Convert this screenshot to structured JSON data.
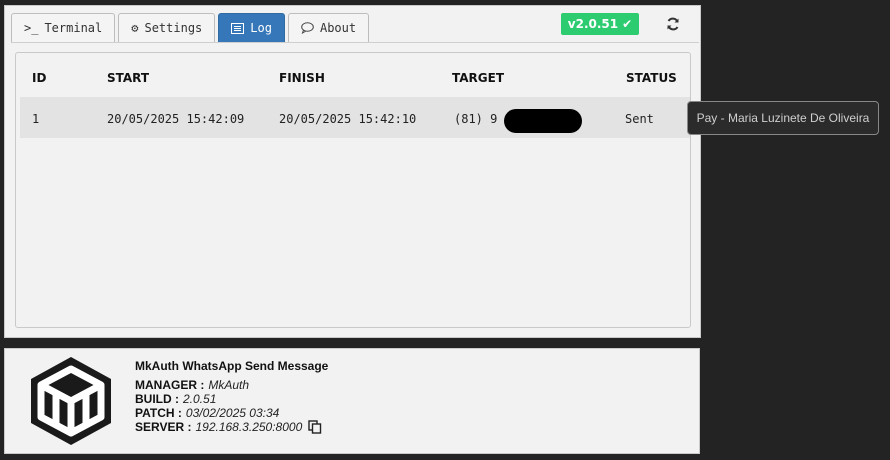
{
  "tabs": [
    {
      "label": "Terminal",
      "icon": "terminal-icon"
    },
    {
      "label": "Settings",
      "icon": "gears-icon"
    },
    {
      "label": "Log",
      "icon": "list-icon",
      "active": true
    },
    {
      "label": "About",
      "icon": "comment-icon"
    }
  ],
  "version_badge": {
    "label": "v2.0.51",
    "icon": "check-icon",
    "color": "#2ecc71"
  },
  "refresh_icon": "refresh-icon",
  "log_table": {
    "headers": [
      "ID",
      "START",
      "FINISH",
      "TARGET",
      "STATUS"
    ],
    "rows": [
      {
        "id": "1",
        "start": "20/05/2025 15:42:09",
        "finish": "20/05/2025 15:42:10",
        "target": "(81) 9",
        "status": "Sent"
      }
    ]
  },
  "tooltip": "Pay - Maria Luzinete De Oliveira",
  "about": {
    "title": "MkAuth WhatsApp Send Message",
    "manager_label": "MANAGER :",
    "manager_value": "MkAuth",
    "build_label": "BUILD :",
    "build_value": "2.0.51",
    "patch_label": "PATCH :",
    "patch_value": "03/02/2025 03:34",
    "server_label": "SERVER :",
    "server_value": "192.168.3.250:8000"
  },
  "colors": {
    "accent": "#3577b8",
    "success": "#2ecc71",
    "background": "#232323"
  }
}
